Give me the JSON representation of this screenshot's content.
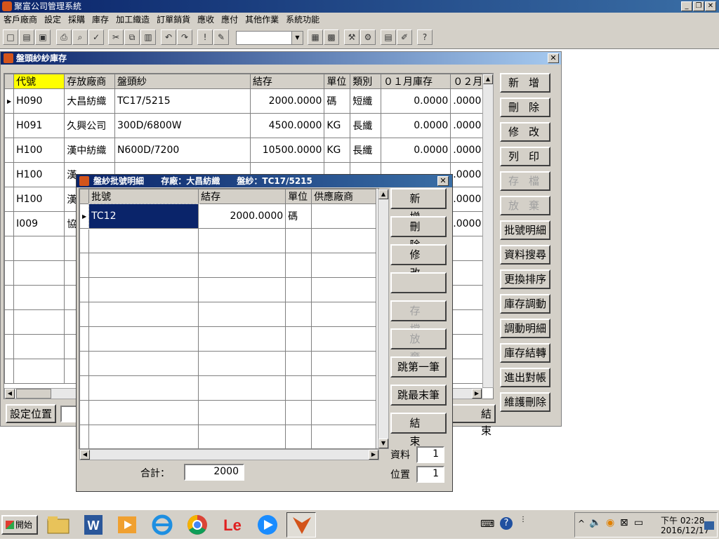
{
  "app": {
    "title": "聚富公司管理系統"
  },
  "menu": [
    "客戶廠商",
    "設定",
    "採購",
    "庫存",
    "加工織造",
    "訂單銷貨",
    "應收",
    "應付",
    "其他作業",
    "系統功能"
  ],
  "main_window": {
    "title": "盤頭紗紗庫存",
    "columns": [
      "代號",
      "存放廠商",
      "盤頭紗",
      "結存",
      "單位",
      "類別",
      "０１月庫存",
      "０２月"
    ],
    "rows": [
      [
        "H090",
        "大昌紡織",
        "TC17/5215",
        "2000.0000",
        "碼",
        "短纖",
        "0.0000",
        ".0000"
      ],
      [
        "H091",
        "久興公司",
        "300D/6800W",
        "4500.0000",
        "KG",
        "長纖",
        "0.0000",
        ".0000"
      ],
      [
        "H100",
        "漢中紡織",
        "N600D/7200",
        "10500.0000",
        "KG",
        "長纖",
        "0.0000",
        ".0000"
      ],
      [
        "H100",
        "漢",
        "",
        "",
        "",
        "",
        "",
        ".0000"
      ],
      [
        "H100",
        "漢",
        "",
        "",
        "",
        "",
        "",
        ".0000"
      ],
      [
        "I009",
        "協",
        "",
        "",
        "",
        "",
        "",
        ".0000"
      ]
    ],
    "buttons": [
      "新增",
      "刪除",
      "修改",
      "列印",
      "存檔",
      "放棄",
      "批號明細",
      "資料搜尋",
      "更換排序",
      "庫存調動",
      "調動明細",
      "庫存結轉",
      "進出對帳",
      "維護刪除"
    ],
    "set_position_label": "設定位置",
    "end_label_partial": "結　　束"
  },
  "dialog": {
    "title": "盤紗批號明細",
    "subtitle_storer": "存廠：大昌紡織",
    "subtitle_yarn": "盤紗：TC17/5215",
    "columns": [
      "批號",
      "結存",
      "單位",
      "供應廠商"
    ],
    "rows": [
      [
        "TC12",
        "2000.0000",
        "碼",
        ""
      ]
    ],
    "buttons": [
      "新增",
      "刪除",
      "修改",
      "",
      "存檔",
      "放棄",
      "跳第一筆",
      "跳最末筆",
      "結束"
    ],
    "total_label": "合計：",
    "total_value": "2000",
    "record_label": "資料",
    "record_value": "1",
    "position_label": "位置",
    "position_value": "1"
  },
  "taskbar": {
    "start_label": "開始",
    "time": "下午 02:28",
    "date": "2016/12/17"
  }
}
